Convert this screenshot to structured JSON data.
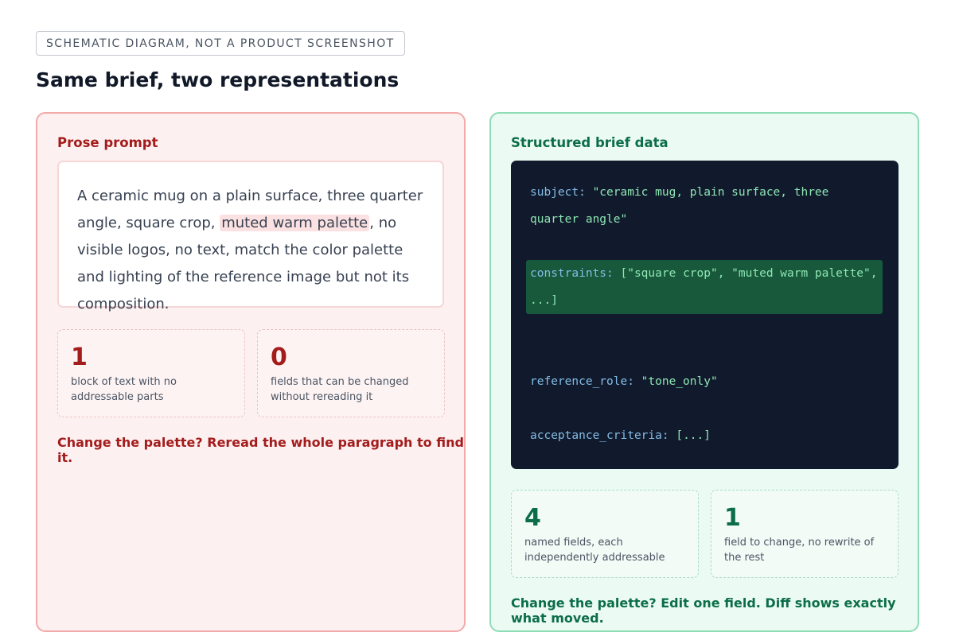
{
  "badge": "SCHEMATIC DIAGRAM, NOT A PRODUCT SCREENSHOT",
  "title": "Same brief, two representations",
  "prose": {
    "heading": "Prose prompt",
    "text_before": "A ceramic mug on a plain surface, three quarter angle, square crop, ",
    "text_highlight": "muted warm palette",
    "text_after": ", no visible logos, no text, match the color palette and lighting of the reference image but not its composition.",
    "stats": [
      {
        "number": "1",
        "desc": "block of text with no addressable parts"
      },
      {
        "number": "0",
        "desc": "fields that can be changed without rereading it"
      }
    ],
    "footer": "Change the palette? Reread the whole paragraph to find it."
  },
  "structured": {
    "heading": "Structured brief data",
    "lines": [
      {
        "key": "subject:",
        "value": " \"ceramic mug, plain surface, three quarter angle\""
      },
      {
        "key": "constraints:",
        "value": " [\"square crop\", \"muted warm palette\", ...]"
      },
      {
        "key": "reference_role:",
        "value": " \"tone_only\""
      },
      {
        "key": "acceptance_criteria:",
        "value": " [...]"
      }
    ],
    "stats": [
      {
        "number": "4",
        "desc": "named fields, each independently addressable"
      },
      {
        "number": "1",
        "desc": "field to change, no rewrite of the rest"
      }
    ],
    "footer": "Change the palette? Edit one field. Diff shows exactly what moved."
  }
}
